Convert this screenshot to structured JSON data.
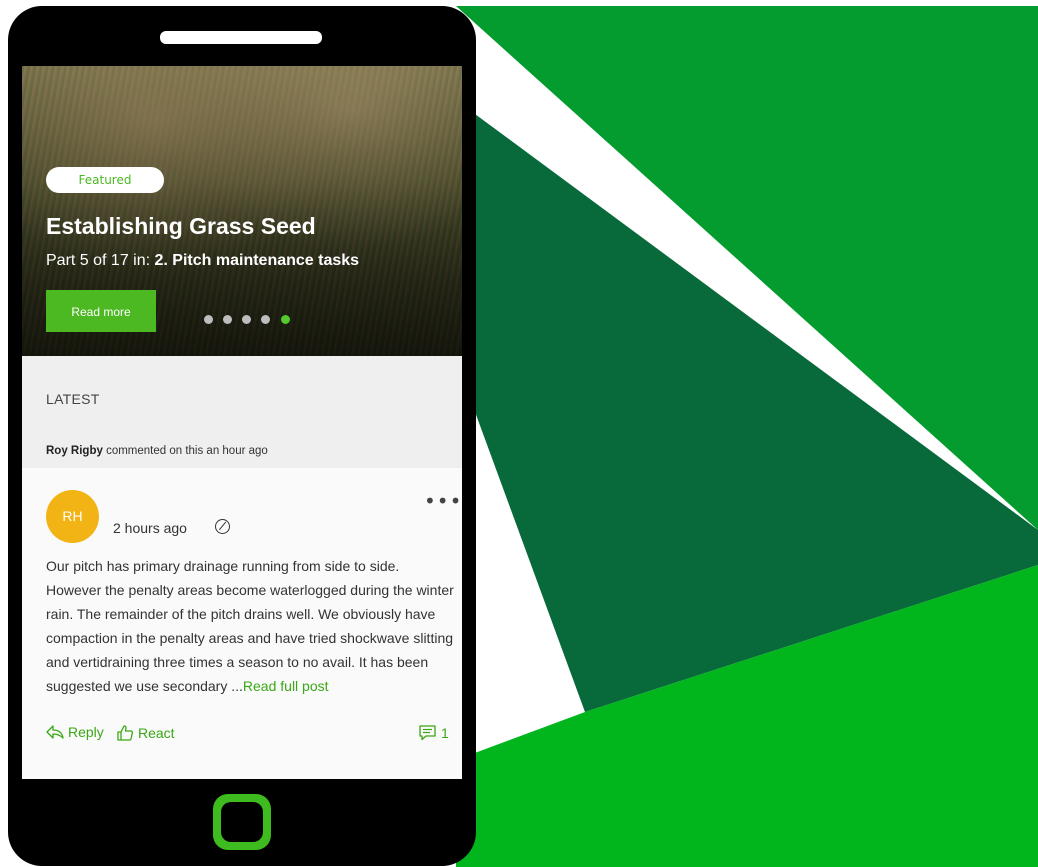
{
  "colors": {
    "brand_green": "#4cb822",
    "dark_green": "#08693a",
    "mid_green": "#059c2f",
    "bright_green": "#00b61c",
    "avatar_bg": "#f2b314"
  },
  "hero": {
    "badge": "Featured",
    "title": "Establishing Grass Seed",
    "subtitle_prefix": "Part 5 of 17 in: ",
    "subtitle_series": "2. Pitch maintenance tasks",
    "read_more": "Read more",
    "carousel": {
      "count": 5,
      "active_index": 5
    }
  },
  "latest": {
    "title": "LATEST",
    "activity_user": "Roy Rigby",
    "activity_text": " commented on this an hour ago"
  },
  "post": {
    "avatar_initials": "RH",
    "time": "2 hours ago",
    "body": "Our pitch has primary drainage running from side to side. However the penalty areas become waterlogged during the winter rain. The remainder of the pitch drains well. We obviously have compaction in the penalty areas and have tried shockwave slitting and vertidraining three times a season to no avail. It has been suggested we use secondary ...",
    "read_full": "Read full post",
    "reply": "Reply",
    "react": "React",
    "comment_count": "1"
  }
}
